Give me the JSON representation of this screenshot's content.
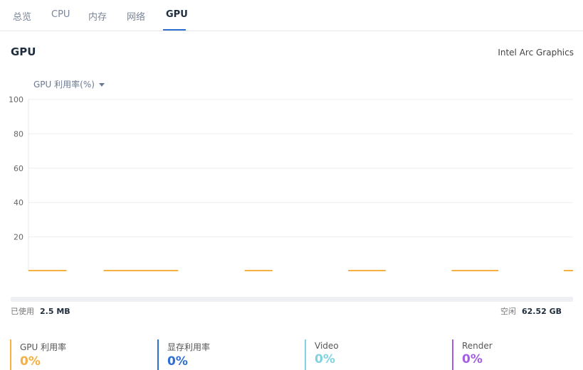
{
  "tabs": [
    {
      "label": "总览",
      "active": false
    },
    {
      "label": "CPU",
      "active": false
    },
    {
      "label": "内存",
      "active": false
    },
    {
      "label": "网络",
      "active": false
    },
    {
      "label": "GPU",
      "active": true
    }
  ],
  "section": {
    "title": "GPU",
    "adapter": "Intel Arc Graphics"
  },
  "metric_select": {
    "selected": "GPU 利用率(%)",
    "icon": "caret-down-icon"
  },
  "chart_data": {
    "type": "line",
    "ylim": [
      0,
      100
    ],
    "yticks": [
      "100",
      "80",
      "60",
      "40",
      "20"
    ],
    "grid": true,
    "series": [
      {
        "color": "#f5b041",
        "segments": [
          [
            0.0,
            0.07
          ],
          [
            0.138,
            0.275
          ],
          [
            0.397,
            0.448
          ],
          [
            0.587,
            0.656
          ],
          [
            0.777,
            0.863
          ],
          [
            0.983,
            1.0
          ]
        ],
        "value": 0
      }
    ]
  },
  "memory": {
    "used_label": "已使用",
    "used_value": "2.5 MB",
    "free_label": "空闲",
    "free_value": "62.52 GB",
    "used_fraction": 4e-05
  },
  "stats": [
    {
      "label": "GPU 利用率",
      "value": "0%",
      "color": "#f5b041"
    },
    {
      "label": "显存利用率",
      "value": "0%",
      "color": "#2f6fd1"
    },
    {
      "label": "Video",
      "value": "0%",
      "color": "#7fd3e0"
    },
    {
      "label": "Render",
      "value": "0%",
      "color": "#a45ee5"
    }
  ]
}
